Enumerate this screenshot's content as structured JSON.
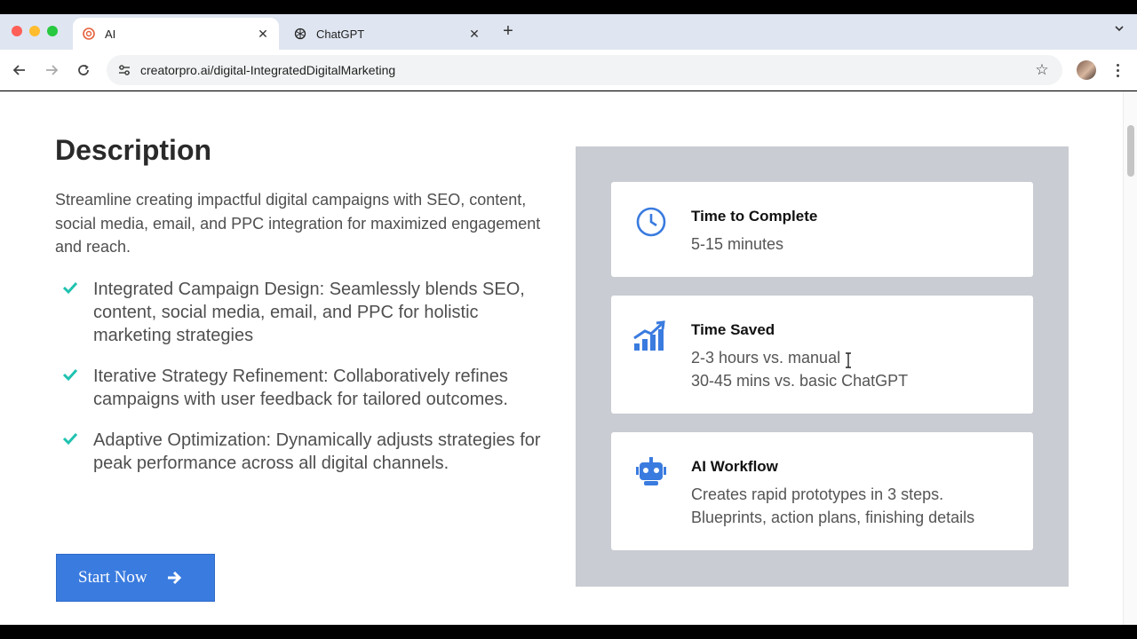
{
  "browser": {
    "tabs": [
      {
        "title": "AI",
        "active": true
      },
      {
        "title": "ChatGPT",
        "active": false
      }
    ],
    "url": "creatorpro.ai/digital-IntegratedDigitalMarketing"
  },
  "description": {
    "heading": "Description",
    "intro": "Streamline creating impactful digital campaigns with SEO, content, social media, email, and PPC integration for maximized engagement and reach.",
    "features": [
      "Integrated Campaign Design: Seamlessly blends SEO, content, social media, email, and PPC for holistic marketing strategies",
      "Iterative Strategy Refinement: Collaboratively refines campaigns with user feedback for tailored outcomes.",
      "Adaptive Optimization: Dynamically adjusts strategies for peak performance across all digital channels."
    ],
    "cta_label": "Start Now"
  },
  "stats": [
    {
      "icon": "clock-icon",
      "title": "Time to Complete",
      "lines": [
        "5-15 minutes"
      ]
    },
    {
      "icon": "growth-chart-icon",
      "title": "Time Saved",
      "lines": [
        "2-3 hours vs. manual",
        "30-45 mins vs. basic ChatGPT"
      ]
    },
    {
      "icon": "robot-icon",
      "title": "AI Workflow",
      "lines": [
        "Creates rapid prototypes in 3 steps.",
        "Blueprints, action plans, finishing details"
      ]
    }
  ],
  "colors": {
    "accent": "#3a7bdf",
    "check": "#1fc2b0",
    "panel": "#c9ccd2"
  }
}
